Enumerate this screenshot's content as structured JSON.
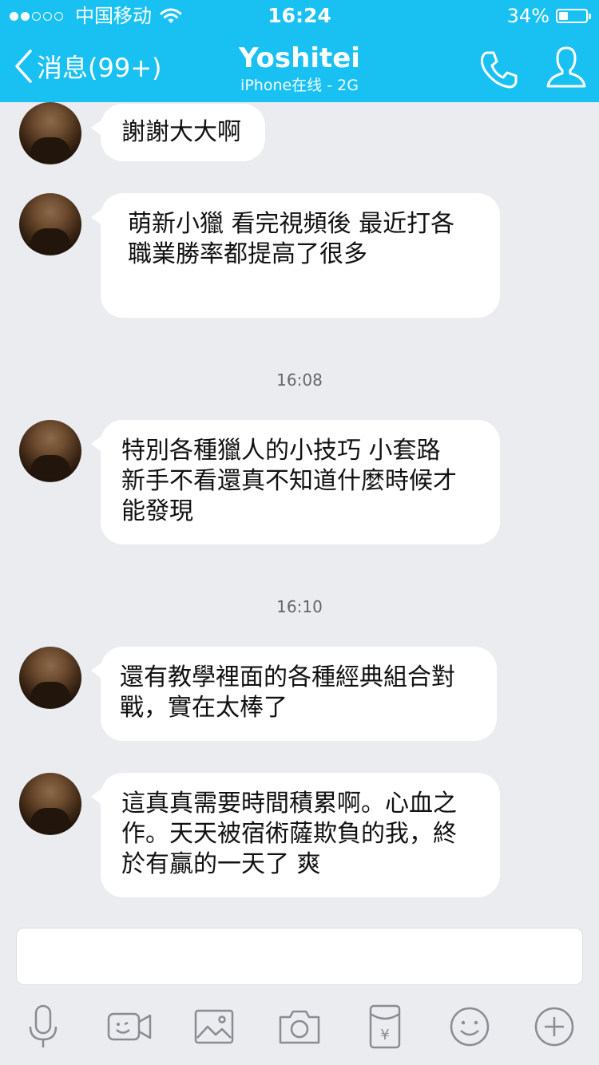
{
  "status_bar": {
    "carrier": "中国移动",
    "time": "16:24",
    "battery": "34%",
    "battery_level": 0.34,
    "signal_bars_filled": 2,
    "signal_bars_total": 5
  },
  "header": {
    "back_label": "消息(99+)",
    "title": "Yoshitei",
    "subtitle": "iPhone在线 - 2G",
    "bg_color": "#19c1f3"
  },
  "messages": [
    {
      "lines": [
        "謝謝大大啊"
      ]
    },
    {
      "lines": [
        "萌新小獵 看完視頻後 最近打各",
        "職業勝率都提高了很多"
      ]
    },
    {
      "time": "16:08"
    },
    {
      "lines": [
        "特別各種獵人的小技巧 小套路",
        "新手不看還真不知道什麼時候才",
        "能發現"
      ]
    },
    {
      "time": "16:10"
    },
    {
      "lines": [
        "還有教學裡面的各種經典組合對",
        "戰，實在太棒了"
      ]
    },
    {
      "lines": [
        "這真真需要時間積累啊。心血之",
        "作。天天被宿術薩欺負的我，終",
        "於有贏的一天了 爽"
      ]
    }
  ],
  "input": {
    "value": ""
  },
  "toolbar": {
    "icons": [
      "microphone-icon",
      "video-call-icon",
      "image-icon",
      "camera-icon",
      "red-packet-icon",
      "emoji-icon",
      "plus-icon"
    ],
    "red_packet_symbol": "¥"
  }
}
